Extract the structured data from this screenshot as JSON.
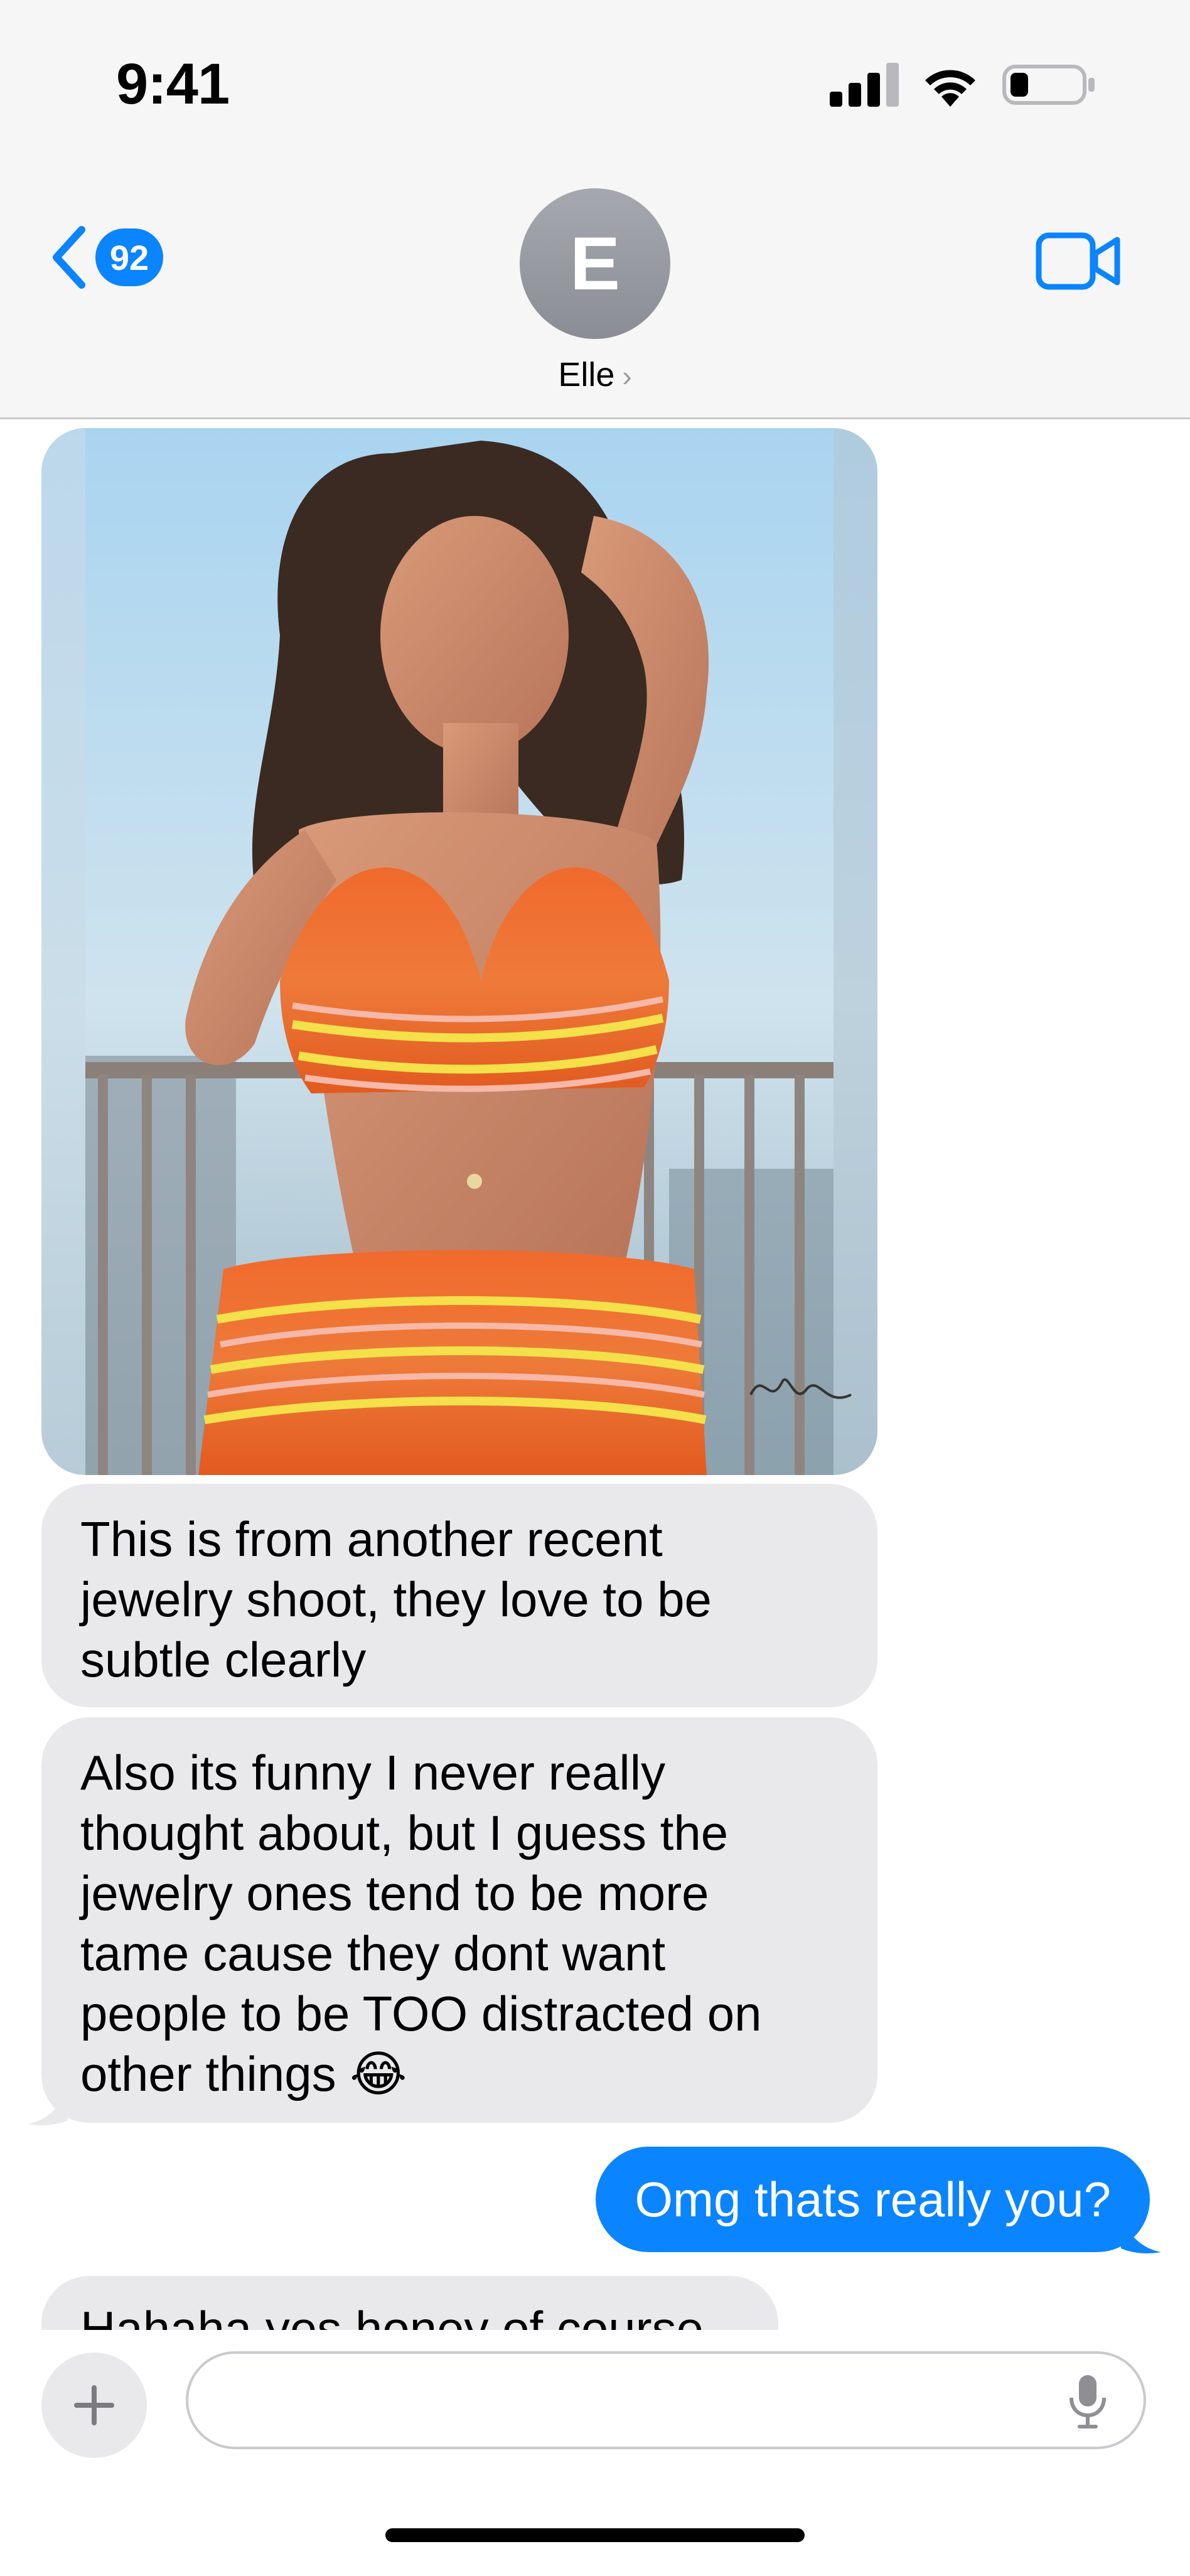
{
  "status_bar": {
    "time": "9:41",
    "icons": [
      "cellular-signal-icon",
      "wifi-icon",
      "battery-icon"
    ]
  },
  "header": {
    "back_badge": "92",
    "avatar_initial": "E",
    "contact_name": "Elle",
    "video_icon": "video-camera-icon"
  },
  "messages": [
    {
      "direction": "incoming",
      "kind": "photo",
      "watermark_signature": "photographer signature"
    },
    {
      "direction": "incoming",
      "lines": [
        "This is from another recent",
        "jewelry shoot, they love to be",
        "subtle clearly"
      ]
    },
    {
      "direction": "incoming",
      "lines": [
        "Also its funny I never really",
        "thought about, but I guess the",
        "jewelry ones tend to be more",
        "tame cause they dont want",
        "people to be TOO distracted on",
        "other things 😂"
      ]
    },
    {
      "direction": "outgoing",
      "text": "Omg thats really you?"
    },
    {
      "direction": "incoming",
      "text": "Hahaha yes honey of course"
    }
  ],
  "composer": {
    "plus_icon": "plus-icon",
    "placeholder": "",
    "mic_icon": "microphone-icon"
  },
  "colors": {
    "accent": "#0a84ff",
    "incoming_bubble": "#e9e9eb",
    "header_bg": "#f6f6f6"
  }
}
